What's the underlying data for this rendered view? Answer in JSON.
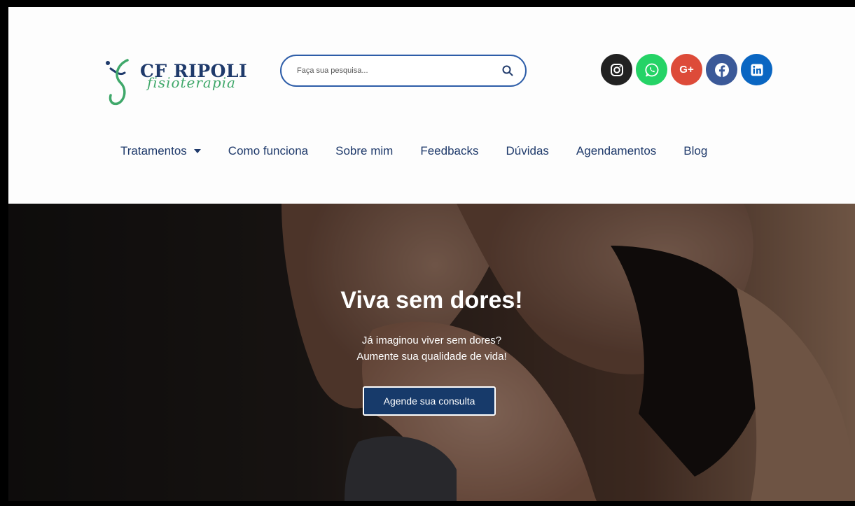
{
  "brand": {
    "name": "CF RIPOLI",
    "tagline": "fisioterapia",
    "colors": {
      "navy": "#1f3a6b",
      "green": "#3fa86a",
      "accent": "#173a6a"
    }
  },
  "search": {
    "placeholder": "Faça sua pesquisa...",
    "value": "",
    "icon": "search-icon"
  },
  "socials": [
    {
      "name": "Instagram",
      "icon": "instagram-icon",
      "color": "#222222"
    },
    {
      "name": "WhatsApp",
      "icon": "whatsapp-icon",
      "color": "#25d366"
    },
    {
      "name": "Google Plus",
      "icon": "google-plus-icon",
      "color": "#dd4b39",
      "glyph": "G+"
    },
    {
      "name": "Facebook",
      "icon": "facebook-icon",
      "color": "#3b5998"
    },
    {
      "name": "LinkedIn",
      "icon": "linkedin-icon",
      "color": "#0a66c2"
    }
  ],
  "nav": {
    "items": [
      {
        "label": "Tratamentos",
        "has_dropdown": true
      },
      {
        "label": "Como funciona"
      },
      {
        "label": "Sobre mim"
      },
      {
        "label": "Feedbacks"
      },
      {
        "label": "Dúvidas"
      },
      {
        "label": "Agendamentos"
      },
      {
        "label": "Blog"
      }
    ]
  },
  "hero": {
    "title": "Viva sem dores!",
    "subtitle_line1": "Já imaginou viver sem dores?",
    "subtitle_line2": "Aumente sua qualidade de vida!",
    "cta_label": "Agende sua consulta"
  }
}
